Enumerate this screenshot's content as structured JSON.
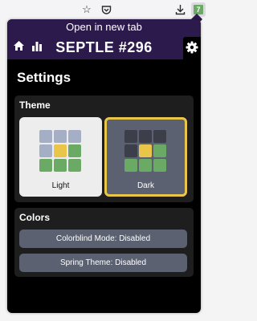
{
  "browser": {
    "extension_letter": "7",
    "icons": [
      "star-outline-icon",
      "pocket-icon",
      "download-icon"
    ]
  },
  "header": {
    "open_new_tab": "Open in new tab",
    "title": "SEPTLE #296",
    "background_color": "#2c1a4d"
  },
  "settings": {
    "title": "Settings",
    "theme": {
      "title": "Theme",
      "options": [
        {
          "label": "Light",
          "selected": false
        },
        {
          "label": "Dark",
          "selected": true
        }
      ],
      "selected_border_color": "#e9c54a",
      "tile_colors": {
        "correct": "#6aaa64",
        "present": "#e9c54a",
        "absent_light": "#a4aec4",
        "absent_dark": "#3c3f4a"
      }
    },
    "colors": {
      "title": "Colors",
      "buttons": [
        {
          "label": "Colorblind Mode: Disabled"
        },
        {
          "label": "Spring Theme: Disabled"
        }
      ]
    }
  }
}
